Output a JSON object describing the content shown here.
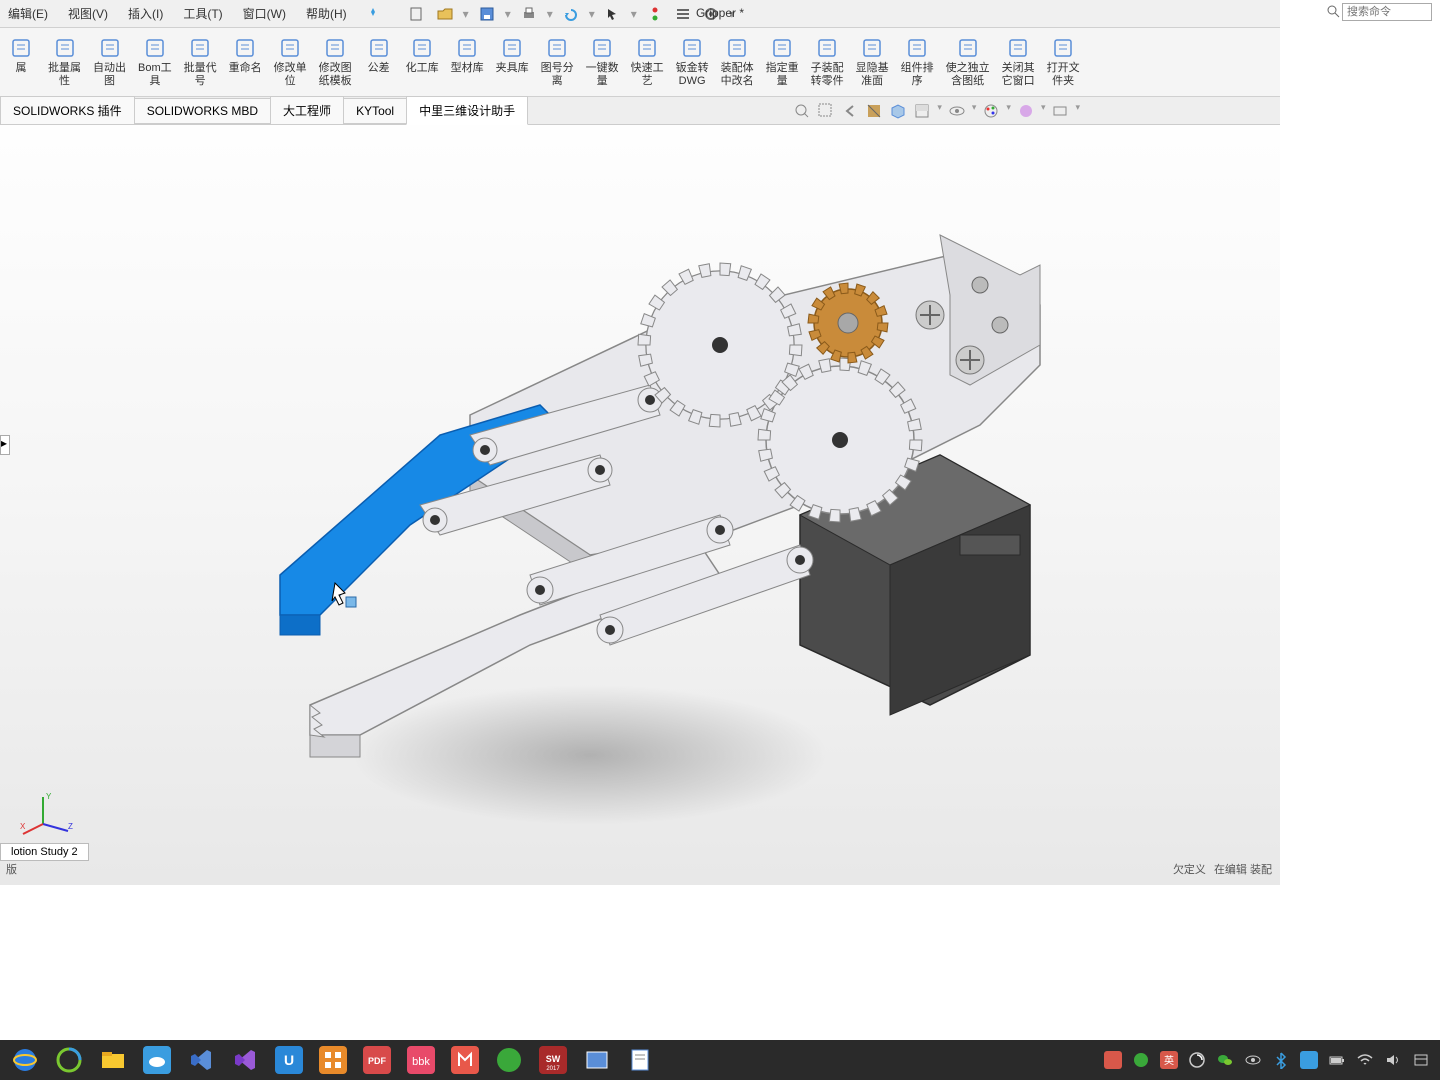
{
  "menus": [
    "编辑(E)",
    "视图(V)",
    "插入(I)",
    "工具(T)",
    "窗口(W)",
    "帮助(H)"
  ],
  "doc_title": "Gripper *",
  "search_placeholder": "搜索命令",
  "ribbon": [
    {
      "id": "prop",
      "label": "属"
    },
    {
      "id": "batch-prop",
      "label": "批量属\n性"
    },
    {
      "id": "auto-drawing",
      "label": "自动出\n图"
    },
    {
      "id": "bom-tool",
      "label": "Bom工\n具"
    },
    {
      "id": "batch-code",
      "label": "批量代\n号"
    },
    {
      "id": "rename",
      "label": "重命名"
    },
    {
      "id": "modify-unit",
      "label": "修改单\n位"
    },
    {
      "id": "modify-drawing",
      "label": "修改图\n纸模板"
    },
    {
      "id": "tolerance",
      "label": "公差"
    },
    {
      "id": "chem-lib",
      "label": "化工库"
    },
    {
      "id": "profile-lib",
      "label": "型材库"
    },
    {
      "id": "fixture-lib",
      "label": "夹具库"
    },
    {
      "id": "pic-separate",
      "label": "图号分\n离"
    },
    {
      "id": "onekey-qty",
      "label": "一键数\n量"
    },
    {
      "id": "quick-process",
      "label": "快速工\n艺"
    },
    {
      "id": "sheetmetal-dwg",
      "label": "钣金转\nDWG"
    },
    {
      "id": "assembly-rename",
      "label": "装配体\n中改名"
    },
    {
      "id": "spec-weight",
      "label": "指定重\n量"
    },
    {
      "id": "child-assembly",
      "label": "子装配\n转零件"
    },
    {
      "id": "show-hide-plane",
      "label": "显隐基\n准面"
    },
    {
      "id": "comp-sort",
      "label": "组件排\n序"
    },
    {
      "id": "make-independent",
      "label": "使之独立\n含图纸"
    },
    {
      "id": "close-others",
      "label": "关闭其\n它窗口"
    },
    {
      "id": "open-folder",
      "label": "打开文\n件夹"
    }
  ],
  "sub_tabs": [
    "SOLIDWORKS 插件",
    "SOLIDWORKS MBD",
    "大工程师",
    "KYTool",
    "中里三维设计助手"
  ],
  "sub_tab_active": 4,
  "bottom_tabs": [
    "lotion Study 2",
    "版"
  ],
  "status_defn": "欠定义",
  "status_edit": "在编辑 装配",
  "colors": {
    "accent": "#0d6efd",
    "selected_part": "#1789e6",
    "gear_bronze": "#c98b3a",
    "base_dark": "#4b4b4b"
  }
}
